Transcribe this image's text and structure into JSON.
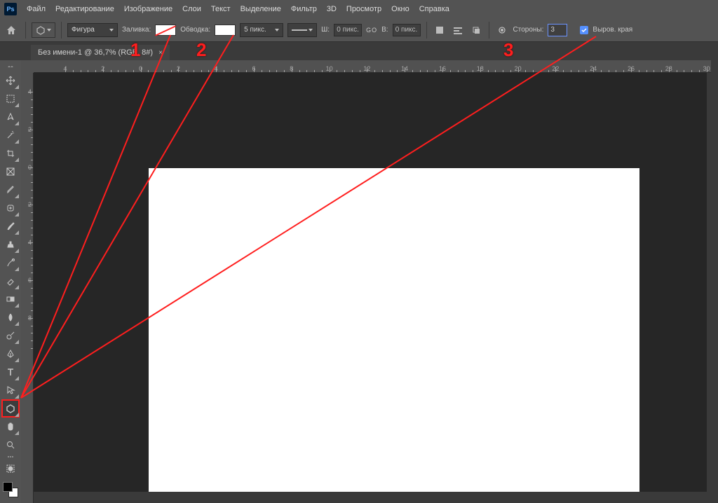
{
  "app": {
    "badge": "Ps"
  },
  "menu": [
    "Файл",
    "Редактирование",
    "Изображение",
    "Слои",
    "Текст",
    "Выделение",
    "Фильтр",
    "3D",
    "Просмотр",
    "Окно",
    "Справка"
  ],
  "options": {
    "mode_label": "Фигура",
    "fill_label": "Заливка:",
    "stroke_label": "Обводка:",
    "stroke_width": "5 пикс.",
    "w_label": "Ш:",
    "w_value": "0 пикс.",
    "link_label": "GO",
    "h_label": "В:",
    "h_value": "0 пикс.",
    "sides_label": "Стороны:",
    "sides_value": "3",
    "align_edges_label": "Выров. края"
  },
  "tab": {
    "title": "Без имени-1 @ 36,7% (RGB, 8#)"
  },
  "ruler": {
    "h_labels": [
      "4",
      "2",
      "0",
      "2",
      "4",
      "6",
      "8",
      "10",
      "12",
      "14",
      "16",
      "18",
      "20",
      "22",
      "24",
      "26",
      "28",
      "30"
    ],
    "v_labels": [
      "4",
      "2",
      "0",
      "2",
      "4",
      "6",
      "8"
    ]
  },
  "annotations": {
    "n1": "1",
    "n2": "2",
    "n3": "3"
  }
}
